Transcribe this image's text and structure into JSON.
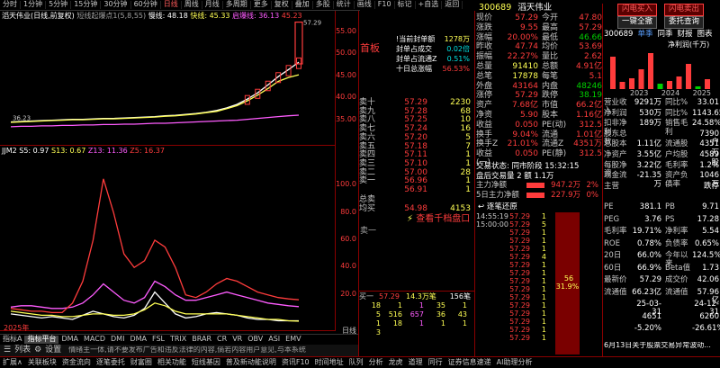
{
  "toolbar": {
    "items": [
      "分时",
      "1分钟",
      "5分钟",
      "15分钟",
      "30分钟",
      "60分钟",
      "日线",
      "周线",
      "月线",
      "多周期",
      "更多"
    ],
    "right": [
      "复权",
      "叠加",
      "多股",
      "统计",
      "画线",
      "F10",
      "标记",
      "+自选",
      "返回"
    ]
  },
  "chart": {
    "title": "滔天伟业(日线,前复权)",
    "indicator": "短线起爆点1(5,8,55)",
    "legend": [
      {
        "label": "慢线: 48.18",
        "color": "#ffffff"
      },
      {
        "label": "快线: 45.33",
        "color": "#ffff54"
      },
      {
        "label": "启爆线: 36.13",
        "color": "#ff5cff"
      },
      {
        "label": "45.23",
        "color": "#ff3c3c"
      }
    ],
    "peak_label": "57.29",
    "low_label": "36.23",
    "sub_title": "JJM2",
    "sub_legend": [
      {
        "label": "S5: 0.97",
        "color": "#ffffff"
      },
      {
        "label": "S13: 0.67",
        "color": "#ffff54"
      },
      {
        "label": "Z13: 11.36",
        "color": "#ff5cff"
      },
      {
        "label": "Z5: 16.37",
        "color": "#ff3c3c"
      }
    ],
    "year": "2025年",
    "x_range": [
      "2024-12",
      "2025"
    ]
  },
  "chart_data": [
    {
      "type": "line",
      "title": "滔天伟业(日线,前复权)",
      "ylim": [
        30,
        57
      ],
      "yticks": [
        "55.00",
        "50.00",
        "45.00",
        "40.00",
        "35.00"
      ],
      "series": [
        {
          "name": "慢线",
          "color": "#ffffff",
          "values": [
            34.6,
            34.7,
            34.8,
            34.9,
            35.0,
            35.1,
            35.2,
            35.2,
            35.3,
            35.4,
            35.4,
            35.5,
            35.6,
            35.7,
            35.8,
            36.0,
            36.1,
            36.3,
            36.5,
            36.8,
            37.2,
            37.8,
            38.6,
            39.8,
            41.2,
            43.0,
            44.9,
            46.5,
            48.18
          ]
        },
        {
          "name": "快线",
          "color": "#ffff54",
          "values": [
            34.5,
            34.6,
            34.7,
            34.8,
            34.9,
            35.0,
            35.1,
            35.1,
            35.2,
            35.3,
            35.3,
            35.4,
            35.5,
            35.6,
            35.7,
            35.9,
            36.0,
            36.2,
            36.4,
            36.7,
            37.0,
            37.6,
            38.3,
            39.4,
            40.7,
            42.2,
            43.8,
            44.7,
            45.33
          ]
        },
        {
          "name": "启爆线",
          "color": "#ff5cff",
          "values": [
            33.5,
            33.6,
            33.6,
            33.7,
            33.7,
            33.8,
            33.8,
            33.9,
            33.9,
            34.0,
            34.0,
            34.1,
            34.1,
            34.2,
            34.3,
            34.3,
            34.4,
            34.5,
            34.6,
            34.7,
            34.8,
            34.9,
            35.0,
            35.2,
            35.4,
            35.6,
            35.8,
            36.0,
            36.13
          ]
        }
      ]
    },
    {
      "type": "line",
      "title": "JJM2",
      "ylim": [
        0,
        120
      ],
      "yticks": [
        "100.0",
        "80.0",
        "60.0",
        "40.0",
        "20.0"
      ],
      "series": [
        {
          "name": "S5",
          "color": "#ffffff",
          "values": [
            6,
            5,
            4,
            3,
            4,
            3,
            2,
            5,
            8,
            6,
            4,
            3,
            5,
            10,
            22,
            14,
            6,
            3,
            4,
            6,
            7,
            6,
            5,
            3,
            2,
            2,
            1,
            1,
            0.97
          ]
        },
        {
          "name": "S13",
          "color": "#ffff54",
          "values": [
            8,
            7,
            6,
            5,
            5,
            4,
            4,
            5,
            6,
            6,
            5,
            5,
            6,
            9,
            14,
            12,
            8,
            6,
            6,
            6,
            6,
            6,
            5,
            4,
            3,
            2,
            2,
            1,
            0.67
          ]
        },
        {
          "name": "Z13",
          "color": "#ff5cff",
          "values": [
            11,
            12,
            12,
            11,
            10,
            10,
            11,
            14,
            20,
            28,
            22,
            16,
            14,
            18,
            30,
            26,
            20,
            16,
            16,
            18,
            20,
            22,
            20,
            18,
            16,
            14,
            13,
            12,
            11.36
          ]
        },
        {
          "name": "Z5",
          "color": "#ff3c3c",
          "values": [
            10,
            9,
            8,
            8,
            7,
            7,
            14,
            30,
            60,
            105,
            80,
            50,
            40,
            45,
            60,
            55,
            40,
            20,
            18,
            22,
            28,
            32,
            30,
            26,
            22,
            20,
            18,
            17,
            16.37
          ]
        }
      ]
    }
  ],
  "bottom_tabs": [
    "指标A",
    "指标平台",
    "DMA",
    "MACD",
    "DMI",
    "DMA",
    "FSL",
    "TRIX",
    "BRAR",
    "CR",
    "VR",
    "OBV",
    "ASI",
    "EMV"
  ],
  "list_bar": {
    "list": "列表",
    "settings": "设置",
    "notice": "情绪主一体,请不要发布广告和违反法律的内容,倘若内容用户意见,与本系统"
  },
  "middle": {
    "shouban": "首板",
    "stats": [
      {
        "k": "!当前封单额",
        "v": "1278万"
      },
      {
        "k": "封单占成交",
        "v": "0.02倍"
      },
      {
        "k": "封单占流通Z",
        "v": "0.51%"
      },
      {
        "k": "十日总涨幅",
        "v": "56.53%"
      }
    ],
    "asks": [
      {
        "l": "卖十",
        "p": "57.29",
        "v": "2230"
      },
      {
        "l": "卖九",
        "p": "57.28",
        "v": "68"
      },
      {
        "l": "卖八",
        "p": "57.25",
        "v": "10"
      },
      {
        "l": "卖七",
        "p": "57.24",
        "v": "16"
      },
      {
        "l": "卖六",
        "p": "57.20",
        "v": "5"
      },
      {
        "l": "卖五",
        "p": "57.18",
        "v": "7"
      },
      {
        "l": "卖四",
        "p": "57.11",
        "v": "1"
      },
      {
        "l": "卖三",
        "p": "57.10",
        "v": "1"
      },
      {
        "l": "卖二",
        "p": "57.00",
        "v": "28"
      },
      {
        "l": "卖一",
        "p": "56.96",
        "v": "1"
      },
      {
        "l": "",
        "p": "56.91",
        "v": "1"
      }
    ],
    "bids_head": [
      {
        "l": "总卖",
        "p": "",
        "v": ""
      },
      {
        "l": "均买",
        "p": "54.98",
        "v": "4153"
      }
    ],
    "chaqian": "查看千档盘口",
    "buy_one": {
      "label": "买一",
      "price": "57.29",
      "qty": "14.3万笔",
      "count": "156笔"
    },
    "queue": [
      [
        "18",
        "1",
        "1",
        "35",
        "1"
      ],
      [
        "5",
        "516",
        "657",
        "36",
        "43"
      ],
      [
        "1",
        "18",
        "1",
        "1",
        "1"
      ],
      [
        "3",
        "",
        "",
        "",
        ""
      ]
    ]
  },
  "quote": {
    "code": "300689",
    "name": "滔天伟业",
    "rows": [
      [
        "现价",
        "57.29",
        "今开",
        "47.80"
      ],
      [
        "涨跌",
        "9.55",
        "最高",
        "57.29"
      ],
      [
        "涨幅",
        "20.00%",
        "最低",
        "46.66"
      ],
      [
        "昨收",
        "47.74",
        "均价",
        "53.69"
      ],
      [
        "振幅",
        "22.27%",
        "量比",
        "2.62"
      ],
      [
        "总量",
        "91410",
        "总额",
        "4.91亿"
      ],
      [
        "总笔",
        "17878",
        "每笔",
        "5.1"
      ],
      [
        "外盘",
        "43164",
        "内盘",
        "48246"
      ],
      [
        "涨停",
        "57.29",
        "跌停",
        "38.19"
      ],
      [
        "资产",
        "7.68亿",
        "市值",
        "66.2亿"
      ],
      [
        "净资",
        "5.90",
        "股本",
        "1.16亿"
      ],
      [
        "收益",
        "0.050",
        "PE(动)",
        "312.5"
      ],
      [
        "换手",
        "9.04%",
        "流通",
        "1.01亿"
      ],
      [
        "换手Z",
        "21.01%",
        "流通Z",
        "4351万"
      ],
      [
        "收益(一)",
        "0.050",
        "PE(静)",
        "312.5"
      ]
    ],
    "status": "交易状态: 同市阶段 15:32:15",
    "flow_head": "盘后交易量 2 额 1.1万",
    "flow": [
      {
        "k": "主力净额",
        "v": "947.2万",
        "p": "2%"
      },
      {
        "k": "5日主力净额",
        "v": "227.9万",
        "p": "0%"
      }
    ],
    "ticks_head": "逐笔还原",
    "ticks": [
      [
        "14:55:19",
        "57.29",
        "1"
      ],
      [
        "15:00:00",
        "57.29",
        "5"
      ],
      [
        "",
        "57.29",
        "1"
      ],
      [
        "",
        "57.29",
        "1"
      ],
      [
        "",
        "57.29",
        "1"
      ],
      [
        "",
        "57.29",
        "4"
      ],
      [
        "",
        "57.29",
        "1"
      ],
      [
        "",
        "57.29",
        "1"
      ],
      [
        "",
        "57.29",
        "1"
      ],
      [
        "",
        "57.29",
        "1"
      ],
      [
        "",
        "57.29",
        "1"
      ],
      [
        "",
        "57.29",
        "1"
      ],
      [
        "",
        "57.29",
        "1"
      ],
      [
        "",
        "57.29",
        "1"
      ],
      [
        "",
        "57.29",
        "1"
      ],
      [
        "",
        "57.29",
        "1"
      ]
    ],
    "big": {
      "qty": "56",
      "pct": "31.9%"
    }
  },
  "right": {
    "buttons": {
      "sell": "闪电买入",
      "fast_sell": "闪电卖出",
      "one_key": "一键全撤",
      "commission": "委托查询"
    },
    "code": "300689",
    "tabs": [
      "单季",
      "同季",
      "财报",
      "图表"
    ],
    "fin_label": "净利润(千万)",
    "years": [
      "2023",
      "2024",
      "2025"
    ],
    "fin_bars": [
      {
        "v": 3.6,
        "c": "#ff3c3c"
      },
      {
        "v": 0.8,
        "c": "#ff3c3c"
      },
      {
        "v": 1.2,
        "c": "#ff3c3c"
      },
      {
        "v": 2.2,
        "c": "#ff3c3c"
      },
      {
        "v": 4.0,
        "c": "#ff3c3c"
      },
      {
        "v": 0.6,
        "c": "#00d000"
      },
      {
        "v": 0.9,
        "c": "#ff3c3c"
      },
      {
        "v": 1.4,
        "c": "#ff3c3c"
      },
      {
        "v": 2.8,
        "c": "#ff3c3c"
      },
      {
        "v": 0.3,
        "c": "#00d000"
      },
      {
        "v": 1.1,
        "c": "#ff3c3c"
      }
    ],
    "fin": [
      [
        "营业收入",
        "9291万",
        "同比%",
        "33.01"
      ],
      [
        "净利润",
        "530万",
        "同比%",
        "1143.65"
      ],
      [
        "扣非净利",
        "189万",
        "销售毛利",
        "24.58%"
      ],
      [
        "股东总数",
        "",
        "",
        "7390户"
      ],
      [
        "总股本",
        "1.11亿",
        "流通股",
        "4351万"
      ],
      [
        "净资产",
        "3.55亿",
        "户均股",
        "4589股"
      ],
      [
        "每股净资",
        "3.22亿",
        "毛利率",
        "1.2%"
      ],
      [
        "现金流",
        "-21.35万",
        "资产负债率",
        "1046万"
      ],
      [
        "主营",
        "",
        "一",
        "跌停"
      ]
    ],
    "val": [
      [
        "PE",
        "381.1",
        "PB",
        "9.71"
      ],
      [
        "PEG",
        "3.76",
        "PS",
        "17.28"
      ],
      [
        "毛利率",
        "19.71%",
        "净利率",
        "5.54"
      ],
      [
        "ROE",
        "0.78%",
        "负债率",
        "0.65%"
      ],
      [
        "20日",
        "66.0%",
        "今年以来",
        "124.5%"
      ],
      [
        "60日",
        "66.9%",
        "Beta值",
        "1.73"
      ],
      [
        "最新价",
        "57.29",
        "成交价",
        "42.06"
      ],
      [
        "流通值",
        "66.23亿",
        "流通值",
        "57.96亿"
      ],
      [
        "",
        "25-03-31",
        "",
        "24-12-31"
      ],
      [
        "",
        "4651",
        "",
        "6260"
      ],
      [
        "",
        "-5.20%",
        "",
        "-26.61%"
      ]
    ],
    "notice": "6月13日关于股票交易异常波动..."
  },
  "status": [
    "扩展∧",
    "关联板块",
    "资金流向",
    "逐笔委托",
    "财富圈",
    "相关功能",
    "短线基因",
    "普及新动能说明",
    "资讯F10",
    "时间地址",
    "队列",
    "分析",
    "龙虎",
    "道理",
    "同行",
    "证券信息速递",
    "AI助理分析"
  ]
}
